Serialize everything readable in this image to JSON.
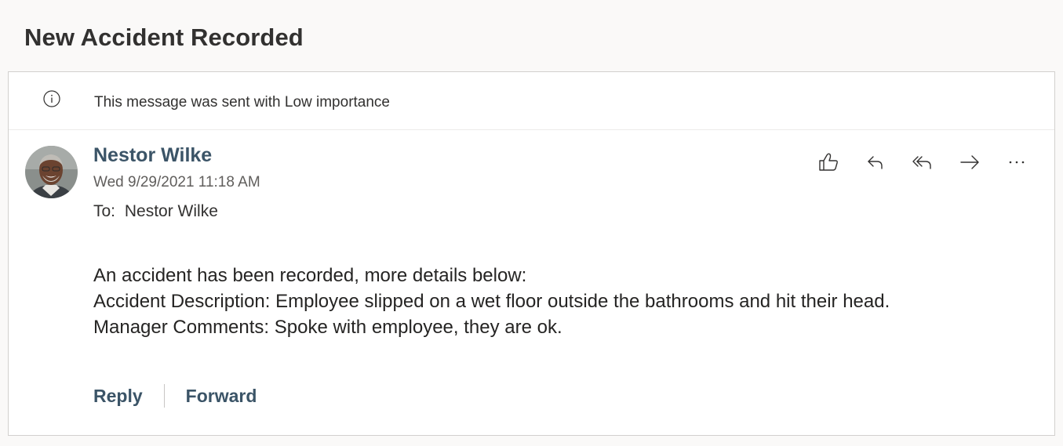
{
  "message": {
    "subject": "New Accident Recorded",
    "importance_notice": "This message was sent with Low importance",
    "sender_name": "Nestor Wilke",
    "sent_datetime": "Wed 9/29/2021 11:18 AM",
    "to_label": "To:",
    "to_recipient": "Nestor Wilke",
    "body_lines": [
      "An accident has been recorded, more details below:",
      "Accident Description: Employee slipped on a wet floor outside the bathrooms and hit their head.",
      "Manager Comments: Spoke with employee, they are ok."
    ]
  },
  "toolbar": {
    "like_icon": "thumbs-up-icon",
    "reply_icon": "reply-icon",
    "reply_all_icon": "reply-all-icon",
    "forward_icon": "forward-arrow-icon",
    "more_icon": "more-horizontal-icon"
  },
  "footer": {
    "reply_label": "Reply",
    "forward_label": "Forward"
  },
  "colors": {
    "accent": "#3b5467",
    "background": "#faf9f8",
    "card": "#ffffff"
  }
}
